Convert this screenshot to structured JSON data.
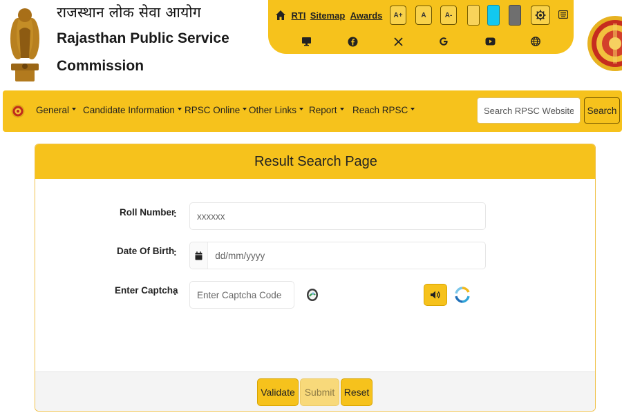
{
  "header": {
    "org_name_hindi": "राजस्थान लोक सेवा आयोग",
    "org_name_line1": "Rajasthan Public Service",
    "org_name_line2": "Commission",
    "links": {
      "rti": "RTI",
      "sitemap": "Sitemap",
      "awards": "Awards"
    },
    "font_size_buttons": {
      "increase": "A+",
      "normal": "A",
      "decrease": "A-"
    },
    "theme_swatches": [
      "#f8d35a",
      "#12c8f0",
      "#6f6f6f"
    ],
    "icons": {
      "home": "home-icon",
      "gear": "gear-icon",
      "keyboard": "keyboard-icon",
      "monitor": "monitor-icon",
      "facebook": "facebook-icon",
      "x": "x-icon",
      "google": "google-icon",
      "youtube": "youtube-icon",
      "globe": "globe-icon"
    }
  },
  "nav": {
    "items": [
      {
        "label": "General"
      },
      {
        "label": "Candidate Information"
      },
      {
        "label": "RPSC Online"
      },
      {
        "label": "Other Links"
      },
      {
        "label": "Report"
      },
      {
        "label": "Reach RPSC"
      }
    ],
    "search_placeholder": "Search RPSC Website",
    "search_button": "Search"
  },
  "form": {
    "title": "Result Search Page",
    "roll_label": "Roll Number",
    "roll_placeholder": "xxxxxx",
    "dob_label": "Date Of Birth",
    "dob_placeholder": "dd/mm/yyyy",
    "captcha_label": "Enter Captcha",
    "captcha_placeholder": "Enter Captcha Code",
    "colon": ":",
    "buttons": {
      "validate": "Validate",
      "submit": "Submit",
      "reset": "Reset"
    }
  },
  "colors": {
    "brand_yellow": "#f6c21c",
    "card_border": "#f0c24c",
    "footer_bg": "#f4f4f4"
  }
}
